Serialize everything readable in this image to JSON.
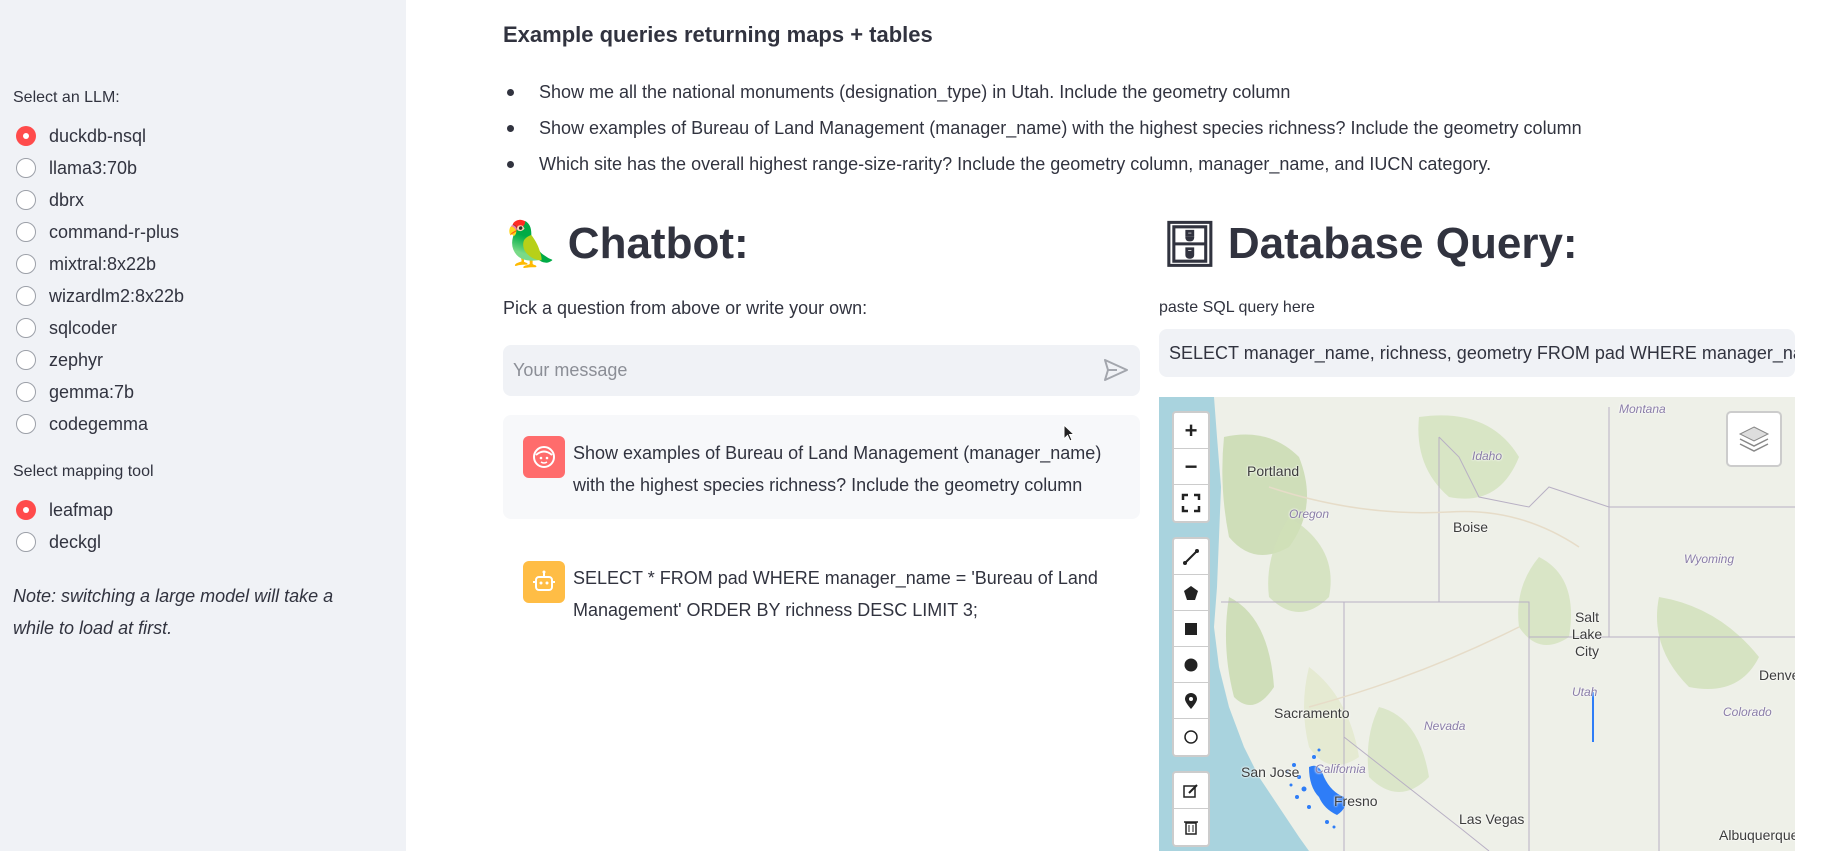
{
  "sidebar": {
    "llm_label": "Select an LLM:",
    "llm_options": [
      {
        "label": "duckdb-nsql",
        "selected": true
      },
      {
        "label": "llama3:70b",
        "selected": false
      },
      {
        "label": "dbrx",
        "selected": false
      },
      {
        "label": "command-r-plus",
        "selected": false
      },
      {
        "label": "mixtral:8x22b",
        "selected": false
      },
      {
        "label": "wizardlm2:8x22b",
        "selected": false
      },
      {
        "label": "sqlcoder",
        "selected": false
      },
      {
        "label": "zephyr",
        "selected": false
      },
      {
        "label": "gemma:7b",
        "selected": false
      },
      {
        "label": "codegemma",
        "selected": false
      }
    ],
    "mapping_label": "Select mapping tool",
    "mapping_options": [
      {
        "label": "leafmap",
        "selected": true
      },
      {
        "label": "deckgl",
        "selected": false
      }
    ],
    "note": "Note: switching a large model will take a while to load at first."
  },
  "examples": {
    "heading": "Example queries returning maps + tables",
    "items": [
      "Show me all the national monuments (designation_type) in Utah. Include the geometry column",
      "Show examples of Bureau of Land Management (manager_name) with the highest species richness? Include the geometry column",
      "Which site has the overall highest range-size-rarity? Include the geometry column, manager_name, and IUCN category."
    ]
  },
  "chatbot": {
    "emoji": "🦜",
    "title": "Chatbot:",
    "prompt_label": "Pick a question from above or write your own:",
    "input_placeholder": "Your message",
    "messages": [
      {
        "role": "user",
        "text": "Show examples of Bureau of Land Management (manager_name) with the highest species richness? Include the geometry column"
      },
      {
        "role": "assistant",
        "text": "SELECT * FROM pad WHERE manager_name = 'Bureau of Land Management' ORDER BY richness DESC LIMIT 3;"
      }
    ]
  },
  "database": {
    "emoji": "🗄",
    "title": "Database Query:",
    "sql_label": "paste SQL query here",
    "sql_value": "SELECT manager_name, richness, geometry FROM pad WHERE manager_name = 'Bureau of Land Management'"
  },
  "map": {
    "controls": {
      "zoom_in": "+",
      "zoom_out": "−"
    },
    "labels": {
      "montana": "Montana",
      "portland": "Portland",
      "idaho": "Idaho",
      "oregon": "Oregon",
      "boise": "Boise",
      "wyoming": "Wyoming",
      "salt_lake_city": "Salt Lake City",
      "denver": "Denve",
      "utah": "Utah",
      "colorado": "Colorado",
      "sacramento": "Sacramento",
      "nevada": "Nevada",
      "san_jose": "San Jose",
      "california": "California",
      "fresno": "Fresno",
      "las_vegas": "Las Vegas",
      "albuquerque": "Albuquerque"
    },
    "colors": {
      "ocean": "#a9d3de",
      "land": "#eef0e8",
      "forest": "#c9dbb0",
      "highlight": "#2e7df7"
    }
  }
}
